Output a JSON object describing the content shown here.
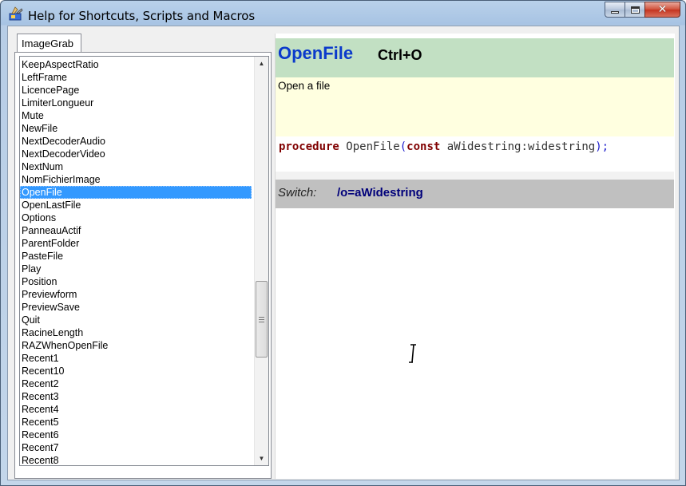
{
  "window": {
    "title": "Help for Shortcuts, Scripts and Macros"
  },
  "tabs": [
    {
      "label": "ImageGrab"
    }
  ],
  "list": {
    "items": [
      "KeepAspectRatio",
      "LeftFrame",
      "LicencePage",
      "LimiterLongueur",
      "Mute",
      "NewFile",
      "NextDecoderAudio",
      "NextDecoderVideo",
      "NextNum",
      "NomFichierImage",
      "OpenFile",
      "OpenLastFile",
      "Options",
      "PanneauActif",
      "ParentFolder",
      "PasteFile",
      "Play",
      "Position",
      "Previewform",
      "PreviewSave",
      "Quit",
      "RacineLength",
      "RAZWhenOpenFile",
      "Recent1",
      "Recent10",
      "Recent2",
      "Recent3",
      "Recent4",
      "Recent5",
      "Recent6",
      "Recent7",
      "Recent8"
    ],
    "selected": "OpenFile"
  },
  "detail": {
    "name": "OpenFile",
    "shortcut": "Ctrl+O",
    "description": "Open a file",
    "code": {
      "kw_procedure": "procedure",
      "name": "OpenFile",
      "open_paren": "(",
      "kw_const": "const",
      "params": "aWidestring:widestring",
      "close": ");"
    },
    "switch_label": "Switch:",
    "switch_value": "/o=aWidestring"
  },
  "colors": {
    "header_bg": "#c2e0c3",
    "description_bg": "#ffffe0",
    "switch_bg": "#c0c0c0",
    "selection": "#3399ff",
    "command_name": "#0b3acb"
  },
  "icons": {
    "app": "app-icon",
    "minimize": "minimize-icon",
    "maximize": "maximize-icon",
    "close": "close-icon",
    "scroll_up": "scroll-up-arrow-icon",
    "scroll_down": "scroll-down-arrow-icon",
    "cursor": "text-cursor-icon"
  }
}
